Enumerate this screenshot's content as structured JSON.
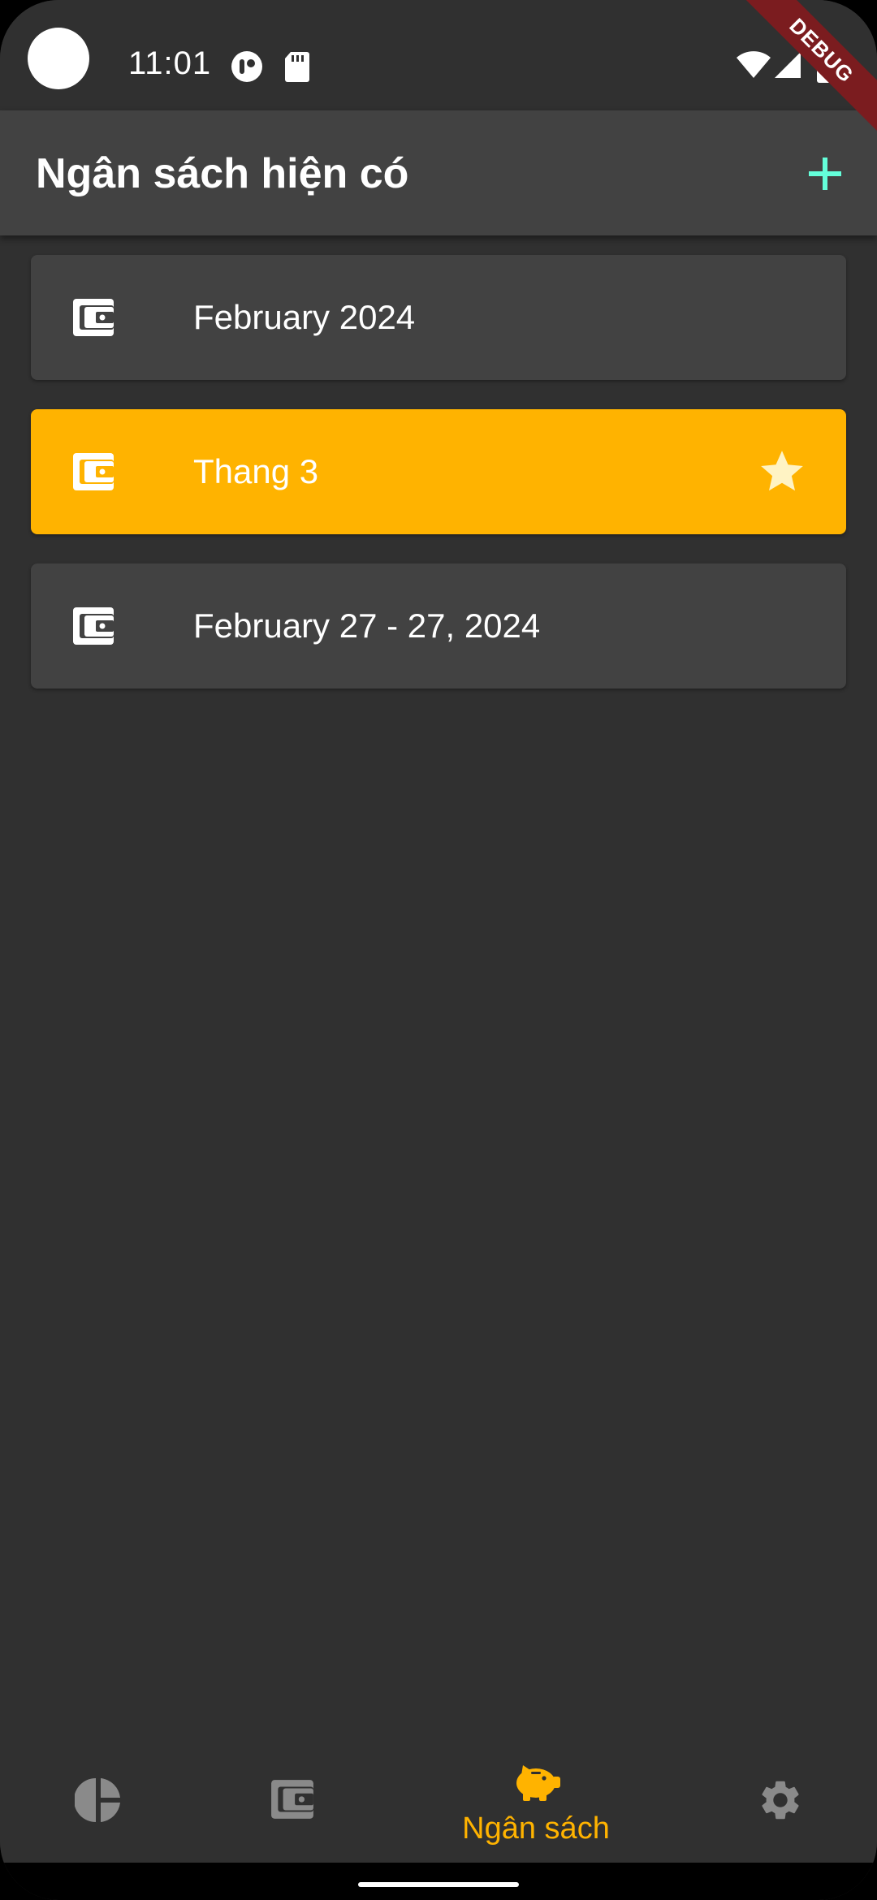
{
  "status_bar": {
    "time": "11:01"
  },
  "debug_banner": {
    "label": "DEBUG"
  },
  "app_bar": {
    "title": "Ngân sách hiện có",
    "add_icon": "plus-icon"
  },
  "budgets": [
    {
      "label": "February 2024",
      "icon": "wallet-icon",
      "active": false,
      "starred": false
    },
    {
      "label": "Thang 3",
      "icon": "wallet-icon",
      "active": true,
      "starred": true
    },
    {
      "label": "February 27 - 27, 2024",
      "icon": "wallet-icon",
      "active": false,
      "starred": false
    }
  ],
  "bottom_nav": {
    "items": [
      {
        "icon": "pie-chart-icon",
        "label": "",
        "selected": false
      },
      {
        "icon": "wallet-icon",
        "label": "",
        "selected": false
      },
      {
        "icon": "piggy-bank-icon",
        "label": "Ngân sách",
        "selected": true
      },
      {
        "icon": "gear-icon",
        "label": "",
        "selected": false
      }
    ]
  },
  "colors": {
    "background": "#303030",
    "surface": "#424242",
    "accent": "#ffb300",
    "add_icon": "#64ffda",
    "nav_inactive": "#8a8a8a",
    "star": "#fff3c4"
  }
}
